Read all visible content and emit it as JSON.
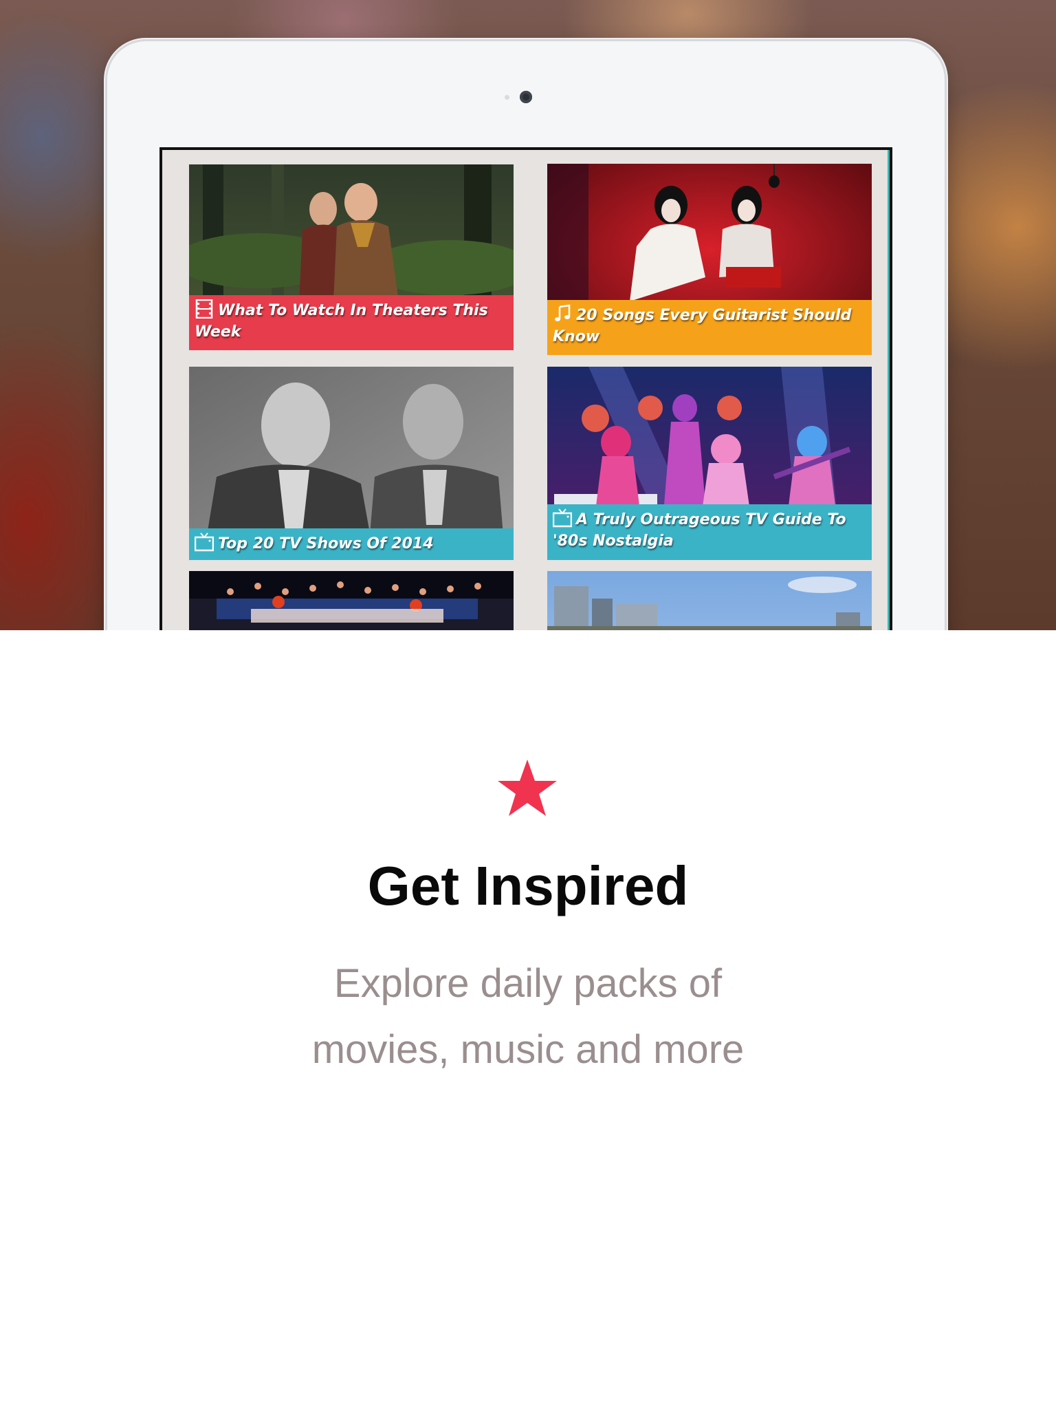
{
  "cards": [
    {
      "title": "What To Watch In Theaters This Week",
      "icon": "film-icon",
      "color": "#e63c4c"
    },
    {
      "title": "20 Songs Every Guitarist Should Know",
      "icon": "music-note-icon",
      "color": "#f5a21a"
    },
    {
      "title": "Top 20 TV Shows Of 2014",
      "icon": "tv-icon",
      "color": "#3bb3c7"
    },
    {
      "title": "A Truly Outrageous TV Guide To '80s Nostalgia",
      "icon": "tv-icon",
      "color": "#3bb3c7"
    }
  ],
  "onboarding": {
    "icon": "star-icon",
    "accent": "#f0334f",
    "title": "Get Inspired",
    "subtitle_line1": "Explore daily packs of",
    "subtitle_line2": "movies, music and more"
  }
}
